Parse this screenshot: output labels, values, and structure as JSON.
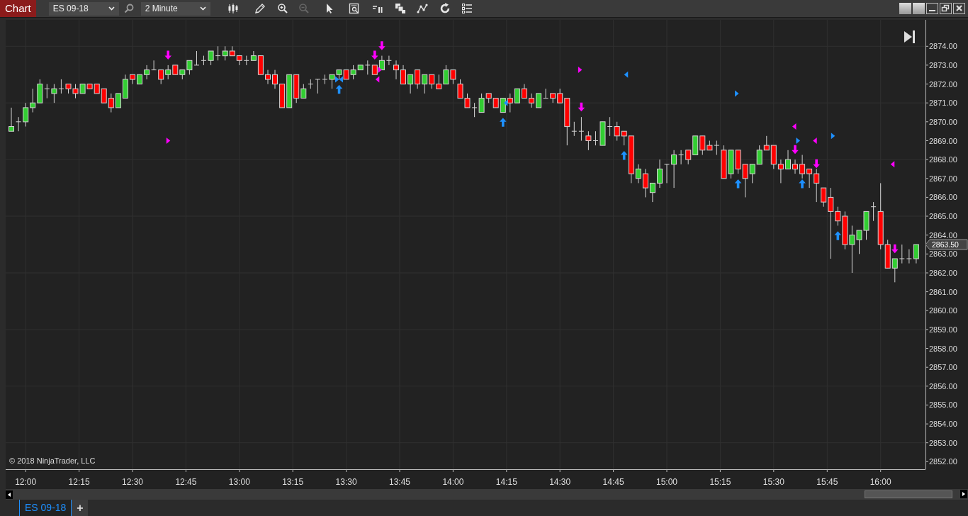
{
  "toolbar": {
    "title": "Chart",
    "instrument": "ES 09-18",
    "interval": "2 Minute",
    "tools": [
      {
        "kind": "bars",
        "disabled": false
      },
      {
        "kind": "pencil",
        "disabled": false
      },
      {
        "kind": "zoom_in",
        "disabled": false
      },
      {
        "kind": "zoom_out",
        "disabled": true
      },
      {
        "kind": "pointer",
        "disabled": false
      },
      {
        "kind": "data_box",
        "disabled": false
      },
      {
        "kind": "bar_spacing",
        "disabled": false
      },
      {
        "kind": "stack",
        "disabled": false
      },
      {
        "kind": "strategy",
        "disabled": false
      },
      {
        "kind": "reload",
        "disabled": false
      },
      {
        "kind": "properties",
        "disabled": false
      }
    ]
  },
  "chart": {
    "copyright": "© 2018 NinjaTrader, LLC",
    "last_price": "2863.50",
    "chart_data": {
      "type": "candlestick",
      "grid": true,
      "xlim": [
        714.4,
        972.6
      ],
      "ylim": [
        2851.6,
        2875.4
      ],
      "yticks": [
        {
          "value": 2874,
          "label": "2874.00"
        },
        {
          "value": 2873,
          "label": "2873.00"
        },
        {
          "value": 2872,
          "label": "2872.00"
        },
        {
          "value": 2871,
          "label": "2871.00"
        },
        {
          "value": 2870,
          "label": "2870.00"
        },
        {
          "value": 2869,
          "label": "2869.00"
        },
        {
          "value": 2868,
          "label": "2868.00"
        },
        {
          "value": 2867,
          "label": "2867.00"
        },
        {
          "value": 2866,
          "label": "2866.00"
        },
        {
          "value": 2865,
          "label": "2865.00"
        },
        {
          "value": 2864,
          "label": "2864.00"
        },
        {
          "value": 2863,
          "label": "2863.00"
        },
        {
          "value": 2862,
          "label": "2862.00"
        },
        {
          "value": 2861,
          "label": "2861.00"
        },
        {
          "value": 2860,
          "label": "2860.00"
        },
        {
          "value": 2859,
          "label": "2859.00"
        },
        {
          "value": 2858,
          "label": "2858.00"
        },
        {
          "value": 2857,
          "label": "2857.00"
        },
        {
          "value": 2856,
          "label": "2856.00"
        },
        {
          "value": 2855,
          "label": "2855.00"
        },
        {
          "value": 2854,
          "label": "2854.00"
        },
        {
          "value": 2853,
          "label": "2853.00"
        },
        {
          "value": 2852,
          "label": "2852.00"
        }
      ],
      "xticks": [
        {
          "value": 720,
          "label": "12:00"
        },
        {
          "value": 735,
          "label": "12:15"
        },
        {
          "value": 750,
          "label": "12:30"
        },
        {
          "value": 765,
          "label": "12:45"
        },
        {
          "value": 780,
          "label": "13:00"
        },
        {
          "value": 795,
          "label": "13:15"
        },
        {
          "value": 810,
          "label": "13:30"
        },
        {
          "value": 825,
          "label": "13:45"
        },
        {
          "value": 840,
          "label": "14:00"
        },
        {
          "value": 855,
          "label": "14:15"
        },
        {
          "value": 870,
          "label": "14:30"
        },
        {
          "value": 885,
          "label": "14:45"
        },
        {
          "value": 900,
          "label": "15:00"
        },
        {
          "value": 915,
          "label": "15:15"
        },
        {
          "value": 930,
          "label": "15:30"
        },
        {
          "value": 945,
          "label": "15:45"
        },
        {
          "value": 960,
          "label": "16:00"
        }
      ],
      "x": [
        716,
        718,
        720,
        722,
        724,
        726,
        728,
        730,
        732,
        734,
        736,
        738,
        740,
        742,
        744,
        746,
        748,
        750,
        752,
        754,
        756,
        758,
        760,
        762,
        764,
        766,
        768,
        770,
        772,
        774,
        776,
        778,
        780,
        782,
        784,
        786,
        788,
        790,
        792,
        794,
        796,
        798,
        800,
        802,
        804,
        806,
        808,
        810,
        812,
        814,
        816,
        818,
        820,
        822,
        824,
        826,
        828,
        830,
        832,
        834,
        836,
        838,
        840,
        842,
        844,
        846,
        848,
        850,
        852,
        854,
        856,
        858,
        860,
        862,
        864,
        866,
        868,
        870,
        872,
        874,
        876,
        878,
        880,
        882,
        884,
        886,
        888,
        890,
        892,
        894,
        896,
        898,
        900,
        902,
        904,
        906,
        908,
        910,
        912,
        914,
        916,
        918,
        920,
        922,
        924,
        926,
        928,
        930,
        932,
        934,
        936,
        938,
        940,
        942,
        944,
        946,
        948,
        950,
        952,
        954,
        956,
        958,
        960,
        962,
        964,
        966,
        968,
        970
      ],
      "ohlc": [
        [
          2869.5,
          2870.75,
          2869.5,
          2869.75
        ],
        [
          2870,
          2870.25,
          2869.5,
          2870
        ],
        [
          2870,
          2871,
          2869.75,
          2870.75
        ],
        [
          2870.75,
          2871.75,
          2870.5,
          2871
        ],
        [
          2871,
          2872.25,
          2871,
          2872
        ],
        [
          2871.75,
          2872,
          2871.25,
          2871.75
        ],
        [
          2871.5,
          2872,
          2871,
          2871.75
        ],
        [
          2871.75,
          2872.25,
          2871.5,
          2871.75
        ],
        [
          2872,
          2872,
          2871.5,
          2871.75
        ],
        [
          2871.75,
          2872,
          2871.25,
          2871.5
        ],
        [
          2871.5,
          2872,
          2871.5,
          2872
        ],
        [
          2872,
          2872,
          2871.75,
          2871.75
        ],
        [
          2872,
          2872,
          2871.5,
          2871.5
        ],
        [
          2871.75,
          2871.75,
          2871,
          2871
        ],
        [
          2871.25,
          2871.5,
          2870.5,
          2870.75
        ],
        [
          2870.75,
          2871.5,
          2870.75,
          2871.5
        ],
        [
          2871.25,
          2872.5,
          2871.25,
          2872.25
        ],
        [
          2872.5,
          2872.5,
          2872,
          2872.25
        ],
        [
          2872,
          2872.5,
          2872,
          2872.5
        ],
        [
          2872.5,
          2873,
          2872.25,
          2872.75
        ],
        [
          2872.75,
          2873.25,
          2872.75,
          2872.75
        ],
        [
          2872.75,
          2872.75,
          2872,
          2872.25
        ],
        [
          2872.5,
          2873,
          2872.25,
          2872.75
        ],
        [
          2873,
          2873,
          2872.5,
          2872.5
        ],
        [
          2872.5,
          2872.75,
          2872.25,
          2872.75
        ],
        [
          2872.75,
          2873.25,
          2872.5,
          2873.25
        ],
        [
          2873,
          2873.75,
          2873,
          2873
        ],
        [
          2873.25,
          2873.5,
          2873,
          2873.25
        ],
        [
          2873.25,
          2873.75,
          2873,
          2873.75
        ],
        [
          2873.5,
          2874,
          2873.25,
          2873.5
        ],
        [
          2873.5,
          2874,
          2873.25,
          2873.75
        ],
        [
          2873.75,
          2874,
          2873.5,
          2873.5
        ],
        [
          2873.5,
          2873.5,
          2873,
          2873.25
        ],
        [
          2873.25,
          2873.5,
          2873,
          2873.25
        ],
        [
          2873.25,
          2873.75,
          2873.25,
          2873.5
        ],
        [
          2873.5,
          2873.5,
          2872.5,
          2872.5
        ],
        [
          2872.5,
          2872.75,
          2872,
          2872.25
        ],
        [
          2872.5,
          2872.75,
          2871.75,
          2872
        ],
        [
          2872,
          2872,
          2870.75,
          2870.75
        ],
        [
          2870.75,
          2872.5,
          2870.75,
          2872.5
        ],
        [
          2872.5,
          2872.5,
          2871,
          2871.25
        ],
        [
          2871.25,
          2872,
          2871.25,
          2871.75
        ],
        [
          2872,
          2872.25,
          2871.75,
          2872
        ],
        [
          2872.25,
          2872.25,
          2871.5,
          2872.25
        ],
        [
          2872.25,
          2872.5,
          2872,
          2872.25
        ],
        [
          2872.25,
          2872.5,
          2871.75,
          2872.5
        ],
        [
          2872.5,
          2872.75,
          2872.25,
          2872.75
        ],
        [
          2872.75,
          2872.75,
          2872.25,
          2872.25
        ],
        [
          2872.5,
          2873,
          2872.25,
          2872.75
        ],
        [
          2872.75,
          2873,
          2872.75,
          2873
        ],
        [
          2873,
          2873.25,
          2872.5,
          2873
        ],
        [
          2873,
          2873,
          2872.5,
          2872.5
        ],
        [
          2872.75,
          2873.5,
          2872.75,
          2873.25
        ],
        [
          2873.25,
          2873.5,
          2873,
          2873.25
        ],
        [
          2873,
          2873.25,
          2872.25,
          2872.75
        ],
        [
          2872.75,
          2873,
          2872,
          2872
        ],
        [
          2872,
          2872.5,
          2871.5,
          2872.5
        ],
        [
          2872.75,
          2872.75,
          2871.75,
          2872
        ],
        [
          2872,
          2872.5,
          2871.5,
          2872.5
        ],
        [
          2872.5,
          2872.5,
          2871.75,
          2872
        ],
        [
          2872,
          2872.5,
          2871.75,
          2871.75
        ],
        [
          2872,
          2873,
          2872,
          2872.75
        ],
        [
          2872.75,
          2872.75,
          2872,
          2872.25
        ],
        [
          2872,
          2872.25,
          2871.25,
          2871.25
        ],
        [
          2871.25,
          2871.5,
          2870.75,
          2870.75
        ],
        [
          2870.75,
          2871,
          2870.25,
          2870.75
        ],
        [
          2870.5,
          2871.5,
          2870.5,
          2871.25
        ],
        [
          2871.5,
          2871.5,
          2871,
          2871.25
        ],
        [
          2871.25,
          2871.25,
          2870.75,
          2870.75
        ],
        [
          2870.5,
          2871.25,
          2870.5,
          2871.25
        ],
        [
          2871.25,
          2871.5,
          2870.5,
          2871
        ],
        [
          2871,
          2871.75,
          2871,
          2871.75
        ],
        [
          2871.75,
          2872,
          2871.25,
          2871.25
        ],
        [
          2871.25,
          2871.5,
          2870.75,
          2871
        ],
        [
          2870.75,
          2871.5,
          2870.75,
          2871.5
        ],
        [
          2871.25,
          2871.75,
          2871.25,
          2871.25
        ],
        [
          2871.5,
          2871.5,
          2871,
          2871.25
        ],
        [
          2871.5,
          2871.75,
          2871,
          2871
        ],
        [
          2871.25,
          2871.25,
          2868.75,
          2869.75
        ],
        [
          2869.5,
          2870,
          2869.25,
          2869.5
        ],
        [
          2869.5,
          2870.25,
          2869,
          2869.5
        ],
        [
          2869.25,
          2869.5,
          2868.5,
          2869
        ],
        [
          2869,
          2869.5,
          2868.75,
          2869
        ],
        [
          2868.75,
          2870,
          2868.75,
          2870
        ],
        [
          2869.75,
          2870.25,
          2869.25,
          2869.75
        ],
        [
          2869.75,
          2870,
          2869,
          2869.25
        ],
        [
          2869.5,
          2869.5,
          2868.75,
          2869.25
        ],
        [
          2869.25,
          2869.25,
          2866.75,
          2867.25
        ],
        [
          2867,
          2867.75,
          2866.75,
          2867.5
        ],
        [
          2867.25,
          2867.5,
          2866,
          2866.5
        ],
        [
          2866.25,
          2866.75,
          2865.75,
          2866.75
        ],
        [
          2866.75,
          2868,
          2866.5,
          2867.5
        ],
        [
          2867.75,
          2867.75,
          2866.75,
          2867.75
        ],
        [
          2867.75,
          2868.5,
          2866.5,
          2868.25
        ],
        [
          2868.25,
          2868.5,
          2867.75,
          2868.25
        ],
        [
          2868.5,
          2868.5,
          2867.75,
          2868
        ],
        [
          2868.25,
          2869.25,
          2868.25,
          2869.25
        ],
        [
          2869.25,
          2869.25,
          2868.25,
          2868.5
        ],
        [
          2868.75,
          2869,
          2868.5,
          2868.5
        ],
        [
          2868.75,
          2869,
          2868.25,
          2868.75
        ],
        [
          2868.5,
          2868.75,
          2867,
          2867
        ],
        [
          2867.25,
          2868.5,
          2867,
          2868.5
        ],
        [
          2868.5,
          2868.5,
          2867.25,
          2867.5
        ],
        [
          2867.75,
          2867.75,
          2866,
          2867
        ],
        [
          2867.25,
          2867.75,
          2866.75,
          2867.75
        ],
        [
          2867.75,
          2868.75,
          2867.75,
          2868.5
        ],
        [
          2868.75,
          2869.25,
          2868.5,
          2868.5
        ],
        [
          2868.75,
          2868.75,
          2867.5,
          2867.75
        ],
        [
          2867.75,
          2868,
          2866.75,
          2867.5
        ],
        [
          2867.5,
          2868.5,
          2867.5,
          2868
        ],
        [
          2867.75,
          2868,
          2867.25,
          2867.5
        ],
        [
          2867.75,
          2868.25,
          2867,
          2867.25
        ],
        [
          2867.5,
          2867.5,
          2866.5,
          2867.25
        ],
        [
          2867.25,
          2867.5,
          2865.75,
          2866.75
        ],
        [
          2866.5,
          2866.5,
          2865.5,
          2865.75
        ],
        [
          2866,
          2866.5,
          2862.75,
          2865.25
        ],
        [
          2865.25,
          2865.5,
          2864.5,
          2864.75
        ],
        [
          2865,
          2865.25,
          2863.25,
          2863.5
        ],
        [
          2863.5,
          2864.5,
          2862,
          2864
        ],
        [
          2863.75,
          2864.25,
          2863,
          2864.25
        ],
        [
          2864.25,
          2865.25,
          2863.75,
          2865.25
        ],
        [
          2865.5,
          2865.75,
          2864.75,
          2865.5
        ],
        [
          2865.25,
          2866.75,
          2863.25,
          2863.5
        ],
        [
          2863.5,
          2863.75,
          2862.25,
          2862.25
        ],
        [
          2862.25,
          2862.75,
          2861.5,
          2862.75
        ],
        [
          2862.75,
          2863.5,
          2862.5,
          2862.75
        ],
        [
          2862.75,
          2863.25,
          2862.5,
          2862.75
        ],
        [
          2862.75,
          2863.5,
          2862.5,
          2863.5
        ]
      ]
    }
  },
  "tabs": [
    {
      "label": "ES 09-18",
      "selected": true
    }
  ],
  "add_tab": "+"
}
